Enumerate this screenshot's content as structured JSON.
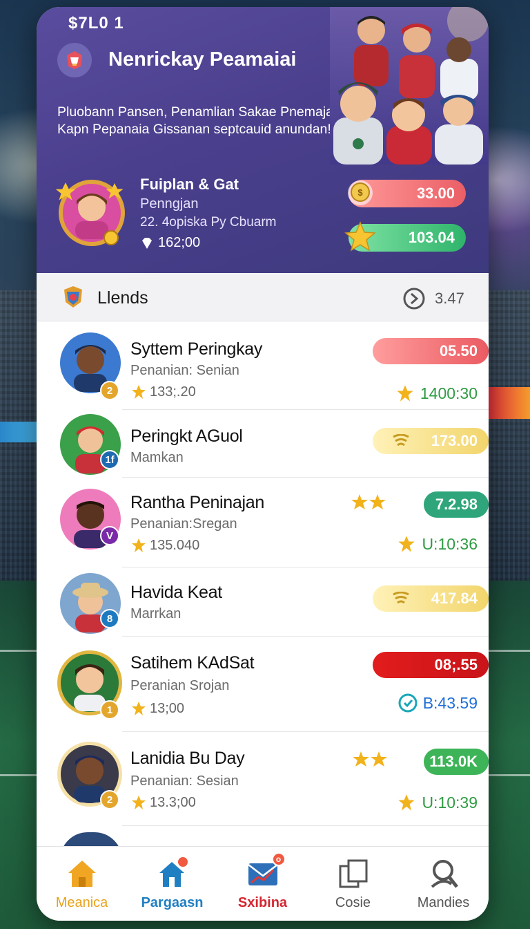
{
  "status": {
    "time": "$7L0 1"
  },
  "header": {
    "app_title": "Nenrickay Peamaiai",
    "tagline_line1": "Pluobann Pansen, Penamlian Sakae Pnemajait",
    "tagline_line2": "Kapn Pepanaia Gissanan septcauid anundan!",
    "icon": "trophy-shield-icon"
  },
  "profile": {
    "name": "Fuiplan & Gat",
    "subtitle": "Penngjan",
    "detail": "22. 4opiska Py Cbuarm",
    "points": "162;00",
    "score_red": "33.00",
    "score_green": "103.04"
  },
  "section": {
    "title": "Llends",
    "timer": "3.47"
  },
  "leaderboard": [
    {
      "name": "Syttem Peringkay",
      "sub": "Penanian: Senian",
      "points": "133;.20",
      "score": "05.50",
      "score_style": "red",
      "time": "1400:30",
      "time_icon": "star",
      "time_color": "#2f9b43",
      "rank": "2",
      "avatar_color": "#2a5fa8"
    },
    {
      "name": "Peringkt AGuol",
      "sub": "Mamkan",
      "points": "",
      "score": "173.00",
      "score_style": "yellow",
      "time": "",
      "time_icon": "",
      "time_color": "",
      "rank": "1f",
      "avatar_color": "#3aa04a"
    },
    {
      "name": "Rantha Peninajan",
      "sub": "Penanian:Sregan",
      "points": "135.040",
      "score": "7.2.98",
      "score_style": "teal",
      "time": "U:10:36",
      "time_icon": "star",
      "time_color": "#2f9b43",
      "rank": "V",
      "avatar_color": "#e56fb0"
    },
    {
      "name": "Havida Keat",
      "sub": "Marrkan",
      "points": "",
      "score": "417.84",
      "score_style": "yellow",
      "time": "",
      "time_icon": "",
      "time_color": "",
      "rank": "8",
      "avatar_color": "#7aa0c8"
    },
    {
      "name": "Satihem KAdSat",
      "sub": "Peranian Srojan",
      "points": "13;00",
      "score": "08;.55",
      "score_style": "deepred",
      "time": "B:43.59",
      "time_icon": "clock",
      "time_color": "#1f6fd6",
      "rank": "1",
      "avatar_color": "#2b7a3a"
    },
    {
      "name": "Lanidia Bu Day",
      "sub": "Penanian: Sesian",
      "points": "13.3;00",
      "score": "113.0K",
      "score_style": "green",
      "time": "U:10:39",
      "time_icon": "star",
      "time_color": "#2f9b43",
      "rank": "2",
      "avatar_color": "#e0b84a"
    }
  ],
  "nav": [
    {
      "label": "Meanica",
      "icon": "home-icon",
      "color": "#e8a21b",
      "badge": ""
    },
    {
      "label": "Pargaasn",
      "icon": "house-notify-icon",
      "color": "#1f7fc2",
      "badge": ""
    },
    {
      "label": "Sxibina",
      "icon": "mail-chart-icon",
      "color": "#d4262f",
      "badge": "o"
    },
    {
      "label": "Cosie",
      "icon": "cards-icon",
      "color": "#555555",
      "badge": ""
    },
    {
      "label": "Mandies",
      "icon": "profile-icon",
      "color": "#555555",
      "badge": ""
    }
  ],
  "colors": {
    "header_bg": "#4a3f8d",
    "accent_red": "#ea5f66",
    "accent_green": "#2fb46b",
    "star_gold": "#f2b21b"
  }
}
